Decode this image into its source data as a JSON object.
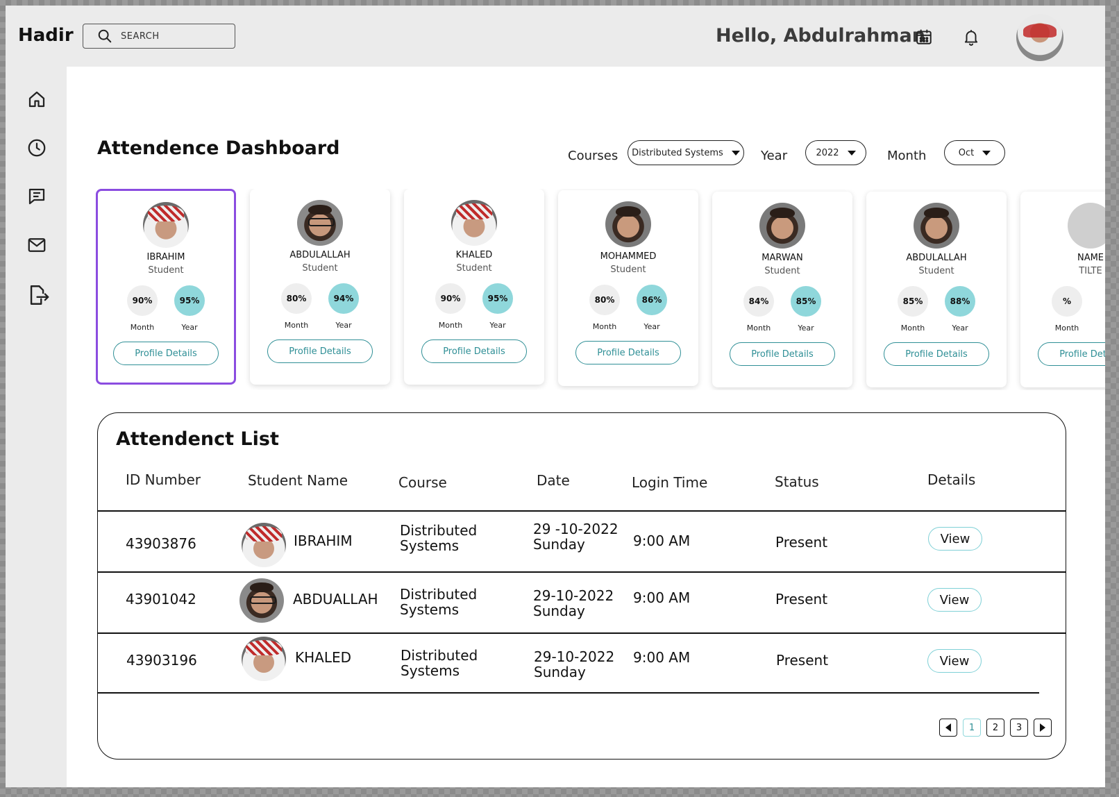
{
  "app": {
    "name": "Hadir"
  },
  "search": {
    "placeholder": "SEARCH"
  },
  "header": {
    "greeting": "Hello, Abdulrahman"
  },
  "icons": {
    "top": [
      "search-icon",
      "calendar-icon",
      "bell-icon",
      "user-avatar"
    ],
    "sidebar": [
      "home-icon",
      "clock-icon",
      "chat-icon",
      "mail-icon",
      "logout-icon"
    ]
  },
  "dashboard": {
    "title": "Attendence Dashboard",
    "filters": {
      "courses_label": "Courses",
      "courses_value": "Distributed Systems",
      "year_label": "Year",
      "year_value": "2022",
      "month_label": "Month",
      "month_value": "Oct"
    }
  },
  "cards": [
    {
      "name": "IBRAHIM",
      "role": "Student",
      "month": "90%",
      "year": "95%",
      "month_label": "Month",
      "year_label": "Year",
      "button": "Profile Details",
      "selected": true,
      "face": "face-ghutra"
    },
    {
      "name": "ABDULALLAH",
      "role": "Student",
      "month": "80%",
      "year": "94%",
      "month_label": "Month",
      "year_label": "Year",
      "button": "Profile Details",
      "face": "face-glasses"
    },
    {
      "name": "KHALED",
      "role": "Student",
      "month": "90%",
      "year": "95%",
      "month_label": "Month",
      "year_label": "Year",
      "button": "Profile Details",
      "face": "face-ghutra"
    },
    {
      "name": "MOHAMMED",
      "role": "Student",
      "month": "80%",
      "year": "86%",
      "month_label": "Month",
      "year_label": "Year",
      "button": "Profile Details",
      "face": "face-plain"
    },
    {
      "name": "MARWAN",
      "role": "Student",
      "month": "84%",
      "year": "85%",
      "month_label": "Month",
      "year_label": "Year",
      "button": "Profile Details",
      "face": "face-plain"
    },
    {
      "name": "ABDULALLAH",
      "role": "Student",
      "month": "85%",
      "year": "88%",
      "month_label": "Month",
      "year_label": "Year",
      "button": "Profile Details",
      "face": "face-plain"
    },
    {
      "name": "NAME",
      "role": "TILTE",
      "month": "%",
      "year": "",
      "month_label": "Month",
      "year_label": "",
      "button": "Profile Details",
      "face": "face-empty"
    }
  ],
  "list": {
    "title": "Attendenct List",
    "headers": {
      "id": "ID Number",
      "name": "Student Name",
      "course": "Course",
      "date": "Date",
      "login": "Login Time",
      "status": "Status",
      "details": "Details"
    },
    "rows": [
      {
        "id": "43903876",
        "name": "IBRAHIM",
        "course1": "Distributed",
        "course2": "Systems",
        "date1": "29 -10-2022",
        "date2": "Sunday",
        "login": "9:00 AM",
        "status": "Present",
        "action": "View"
      },
      {
        "id": "43901042",
        "name": "ABDUALLAH",
        "course1": "Distributed",
        "course2": "Systems",
        "date1": "29-10-2022",
        "date2": "Sunday",
        "login": "9:00 AM",
        "status": "Present",
        "action": "View"
      },
      {
        "id": "43903196",
        "name": "KHALED",
        "course1": "Distributed",
        "course2": "Systems",
        "date1": "29-10-2022",
        "date2": "Sunday",
        "login": "9:00 AM",
        "status": "Present",
        "action": "View"
      }
    ],
    "pagination": {
      "pages": [
        "1",
        "2",
        "3"
      ],
      "current": "1"
    }
  },
  "colors": {
    "accent": "#8fd7db",
    "accent_text": "#2f8f96",
    "selection": "#8b4ce0"
  }
}
